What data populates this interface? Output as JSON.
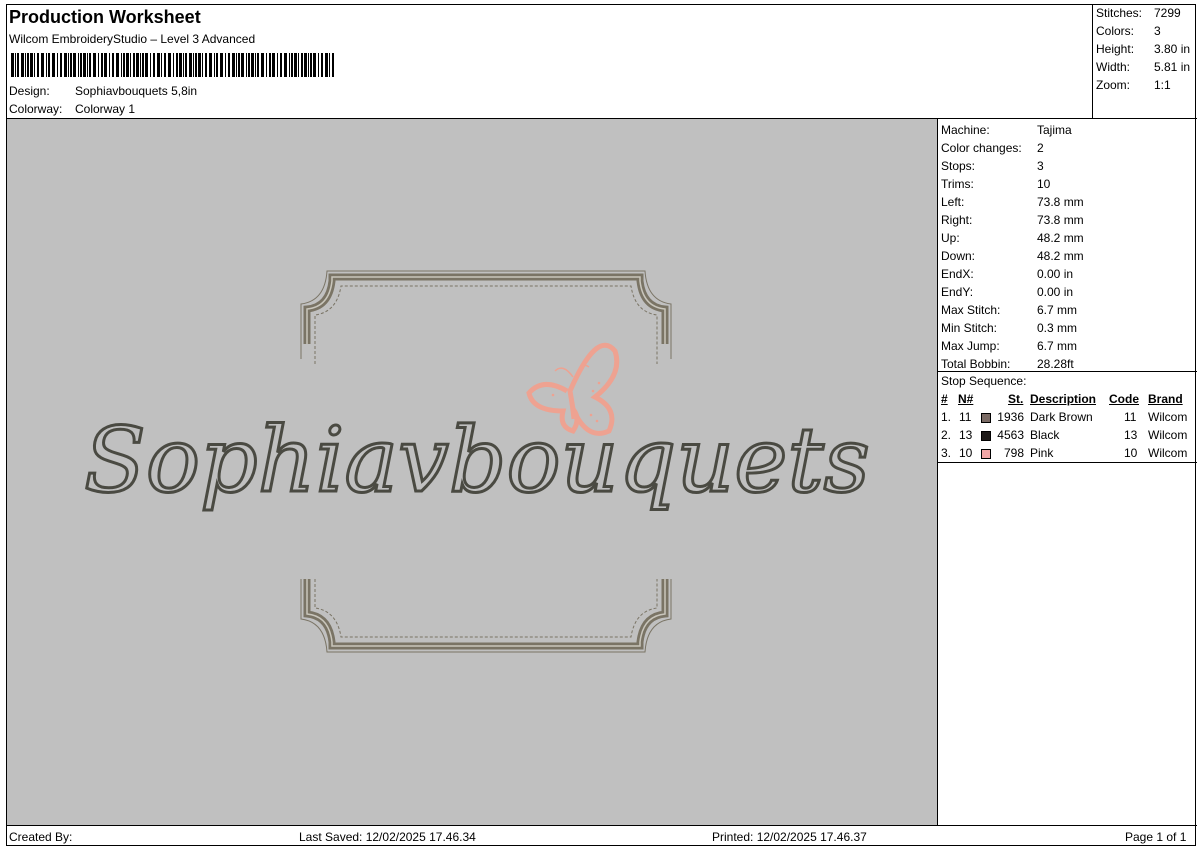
{
  "header": {
    "title": "Production Worksheet",
    "subtitle": "Wilcom EmbroideryStudio – Level 3 Advanced",
    "design_label": "Design:",
    "design_value": "Sophiavbouquets 5,8in",
    "colorway_label": "Colorway:",
    "colorway_value": "Colorway 1"
  },
  "summary": [
    {
      "label": "Stitches:",
      "value": "7299"
    },
    {
      "label": "Colors:",
      "value": "3"
    },
    {
      "label": "Height:",
      "value": "3.80 in"
    },
    {
      "label": "Width:",
      "value": "5.81 in"
    },
    {
      "label": "Zoom:",
      "value": "1:1"
    }
  ],
  "preview": {
    "design_text": "Sophiavbouquets",
    "background_color": "#c0c0c0",
    "frame_color": "#7a7465",
    "text_color": "#4a4a42",
    "butterfly_color": "#eea291"
  },
  "machine_info": [
    {
      "label": "Machine:",
      "value": "Tajima"
    },
    {
      "label": "Color changes:",
      "value": "2"
    },
    {
      "label": "Stops:",
      "value": "3"
    },
    {
      "label": "Trims:",
      "value": "10"
    },
    {
      "label": "Left:",
      "value": "73.8 mm"
    },
    {
      "label": "Right:",
      "value": "73.8 mm"
    },
    {
      "label": "Up:",
      "value": "48.2 mm"
    },
    {
      "label": "Down:",
      "value": "48.2 mm"
    },
    {
      "label": "EndX:",
      "value": "0.00 in"
    },
    {
      "label": "EndY:",
      "value": "0.00 in"
    },
    {
      "label": "Max Stitch:",
      "value": "6.7 mm"
    },
    {
      "label": "Min Stitch:",
      "value": "0.3 mm"
    },
    {
      "label": "Max Jump:",
      "value": "6.7 mm"
    },
    {
      "label": "Total Bobbin:",
      "value": "28.28ft"
    }
  ],
  "stop_sequence": {
    "title": "Stop Sequence:",
    "columns": {
      "num": "#",
      "n": "N#",
      "st": "St.",
      "description": "Description",
      "code": "Code",
      "brand": "Brand"
    },
    "rows": [
      {
        "num": "1.",
        "n": "11",
        "color": "#7a6a64",
        "st": "1936",
        "description": "Dark Brown",
        "code": "11",
        "brand": "Wilcom"
      },
      {
        "num": "2.",
        "n": "13",
        "color": "#1e1a18",
        "st": "4563",
        "description": "Black",
        "code": "13",
        "brand": "Wilcom"
      },
      {
        "num": "3.",
        "n": "10",
        "color": "#f2a6a6",
        "st": "798",
        "description": "Pink",
        "code": "10",
        "brand": "Wilcom"
      }
    ]
  },
  "footer": {
    "created_by": "Created By:",
    "last_saved": "Last Saved: 12/02/2025 17.46.34",
    "printed": "Printed: 12/02/2025 17.46.37",
    "page": "Page 1 of 1"
  }
}
